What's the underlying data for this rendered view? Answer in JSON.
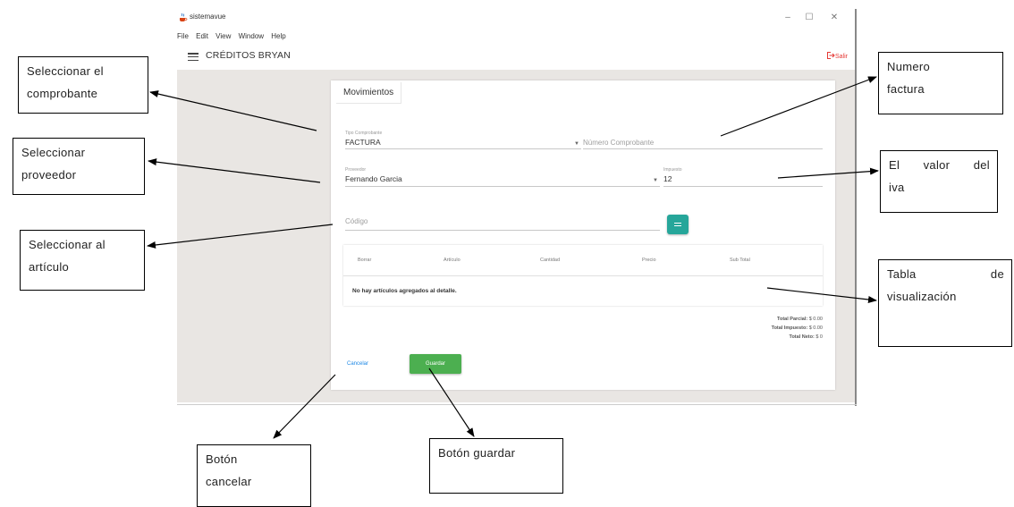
{
  "window": {
    "app_title": "sistemavue",
    "controls": {
      "minimize": "–",
      "maximize": "☐",
      "close": "✕"
    },
    "menu": [
      "File",
      "Edit",
      "View",
      "Window",
      "Help"
    ],
    "heading": "CRÉDITOS BRYAN",
    "logout": "Salir"
  },
  "form": {
    "tab": "Movimientos",
    "tipo_comprobante": {
      "label": "Tipo Comprobante",
      "value": "FACTURA"
    },
    "numero_comprobante": {
      "placeholder": "Número Comprobante"
    },
    "proveedor": {
      "label": "Proveedor",
      "value": "Fernando Garcia"
    },
    "impuesto": {
      "label": "Impuesto",
      "value": "12"
    },
    "codigo": {
      "placeholder": "Código"
    },
    "table": {
      "headers": [
        "Borrar",
        "Artículo",
        "Cantidad",
        "Precio",
        "Sub Total"
      ],
      "empty_message": "No hay artículos agregados al detalle."
    },
    "totals": {
      "parcial_label": "Total Parcial:",
      "parcial_value": "$ 0.00",
      "impuesto_label": "Total Impuesto:",
      "impuesto_value": "$ 0.00",
      "neto_label": "Total Neto:",
      "neto_value": "$ 0"
    },
    "cancel": "Cancelar",
    "save": "Guardar"
  },
  "annotations": {
    "comprobante": [
      "Seleccionar el",
      "comprobante"
    ],
    "proveedor": [
      "Seleccionar",
      "proveedor"
    ],
    "articulo": [
      "Seleccionar al",
      "artículo"
    ],
    "factura": [
      "Numero",
      "factura"
    ],
    "iva": [
      "El valor del",
      "iva"
    ],
    "tabla": [
      "Tabla de",
      "visualización"
    ],
    "cancelar": [
      "Botón",
      "cancelar"
    ],
    "guardar": [
      "Botón guardar"
    ]
  },
  "colors": {
    "teal_button": "#26a69a",
    "save_green": "#4caf50",
    "cancel_blue": "#1e88e5",
    "logout_red": "#e53935",
    "content_bg": "#e9e6e3"
  },
  "icons": {
    "app": "java-cup-icon",
    "menu": "hamburger-icon",
    "logout": "logout-icon",
    "code_button": "list-icon",
    "dropdown": "caret-down-icon"
  }
}
